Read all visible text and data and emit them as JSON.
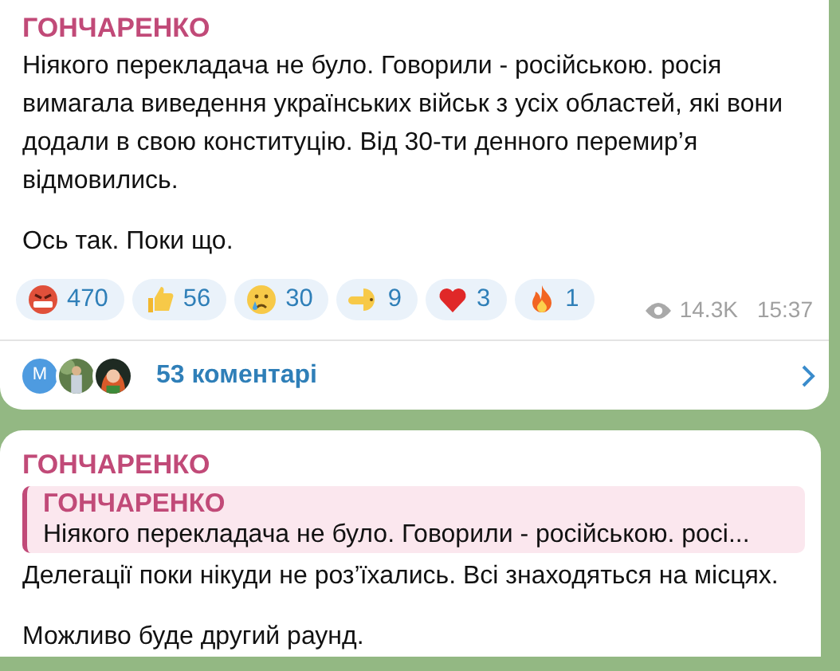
{
  "posts": [
    {
      "author": "ГОНЧАРЕНКО",
      "paragraphs": [
        "Ніякого перекладача не було. Говорили - російською. росія вимагала виведення українських військ з усіх областей, які вони додали в свою конституцію. Від 30-ти денного перемир’я відмовились.",
        "Ось так. Поки що."
      ],
      "reactions": [
        {
          "kind": "angry",
          "count": "470"
        },
        {
          "kind": "thumbs-up",
          "count": "56"
        },
        {
          "kind": "crying",
          "count": "30"
        },
        {
          "kind": "pointing",
          "count": "9"
        },
        {
          "kind": "heart",
          "count": "3"
        },
        {
          "kind": "fire",
          "count": "1"
        }
      ],
      "views": "14.3K",
      "time": "15:37",
      "comments": {
        "avatars": [
          {
            "kind": "letter",
            "letter": "M"
          },
          {
            "kind": "picture"
          },
          {
            "kind": "picture"
          }
        ],
        "label": "53 коментарі"
      }
    },
    {
      "author": "ГОНЧАРЕНКО",
      "reply": {
        "author": "ГОНЧАРЕНКО",
        "text": "Ніякого перекладача не було. Говорили - російською. росі..."
      },
      "paragraphs": [
        "Делегації поки нікуди не роз’їхались. Всі знаходяться на місцях.",
        "Можливо буде другий раунд."
      ]
    }
  ]
}
